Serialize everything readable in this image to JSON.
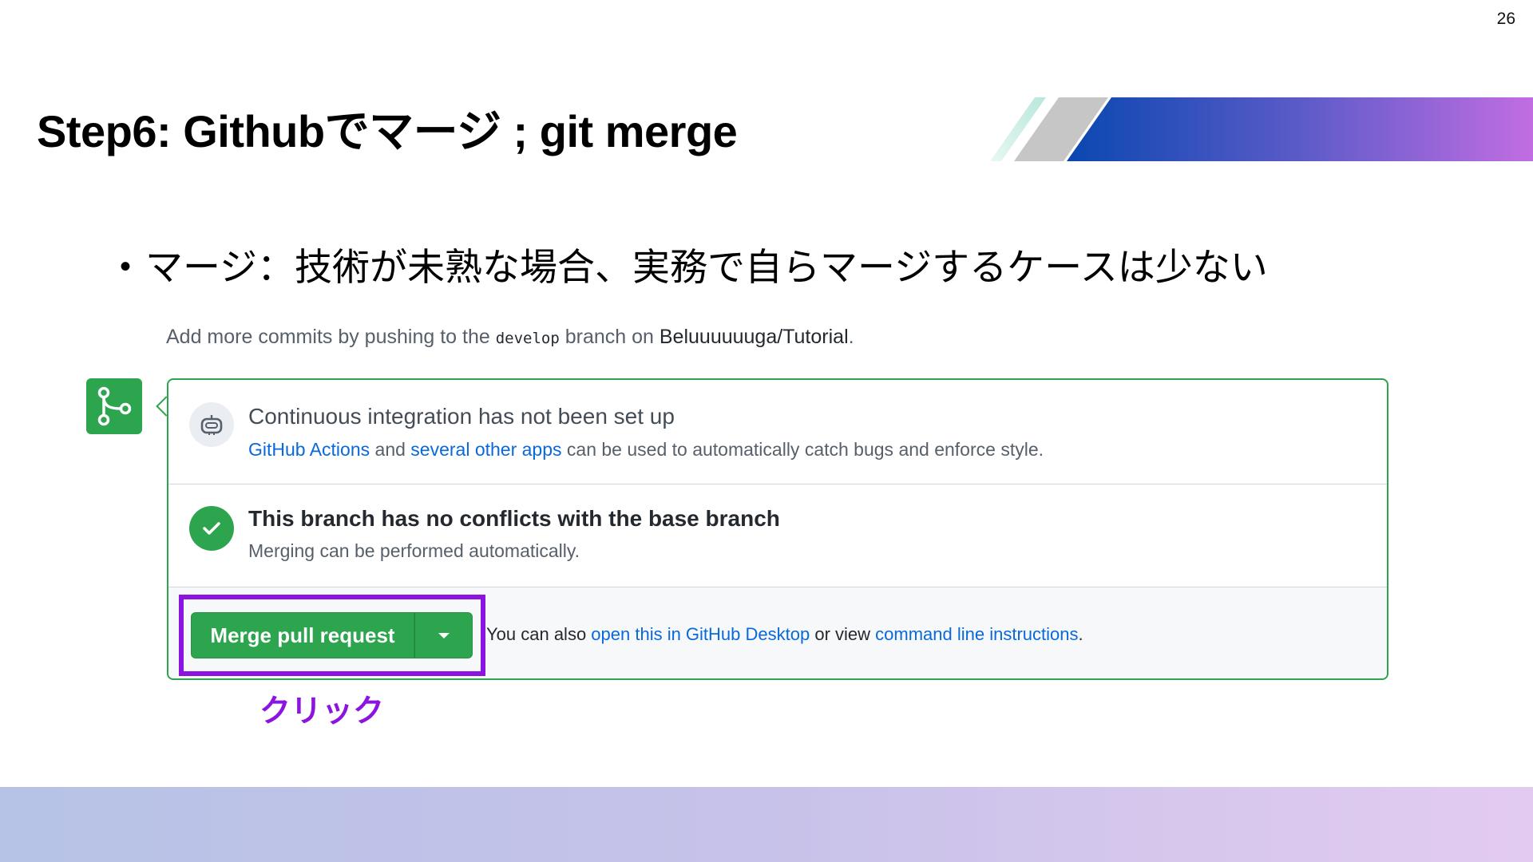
{
  "page_number": "26",
  "title": "Step6: Githubでマージ ; git merge",
  "bullet": {
    "marker": "•",
    "text": "マージ：技術が未熟な場合、実務で自らマージするケースは少ない"
  },
  "screenshot": {
    "hint": {
      "prefix": "Add more commits by pushing to the ",
      "branch": "develop",
      "middle": " branch on ",
      "repo": "Beluuuuuuga/Tutorial",
      "suffix": "."
    },
    "ci_section": {
      "title": "Continuous integration has not been set up",
      "link1": "GitHub Actions",
      "text1": " and ",
      "link2": "several other apps",
      "text2": " can be used to automatically catch bugs and enforce style."
    },
    "conflict_section": {
      "title": "This branch has no conflicts with the base branch",
      "desc": "Merging can be performed automatically."
    },
    "merge_section": {
      "button_label": "Merge pull request",
      "also_prefix": "You can also ",
      "link1": "open this in GitHub Desktop",
      "middle": " or view ",
      "link2": "command line instructions",
      "suffix": "."
    }
  },
  "annotation": {
    "label": "クリック",
    "color": "#8b14e0"
  },
  "colors": {
    "github_green": "#2da44e",
    "link_blue": "#0969da",
    "gradient_start": "#0a47b0",
    "gradient_end": "#c26de2"
  },
  "icons": {
    "merge": "git-merge-icon",
    "ci": "robot-icon",
    "check": "check-icon",
    "caret": "caret-down-icon"
  }
}
